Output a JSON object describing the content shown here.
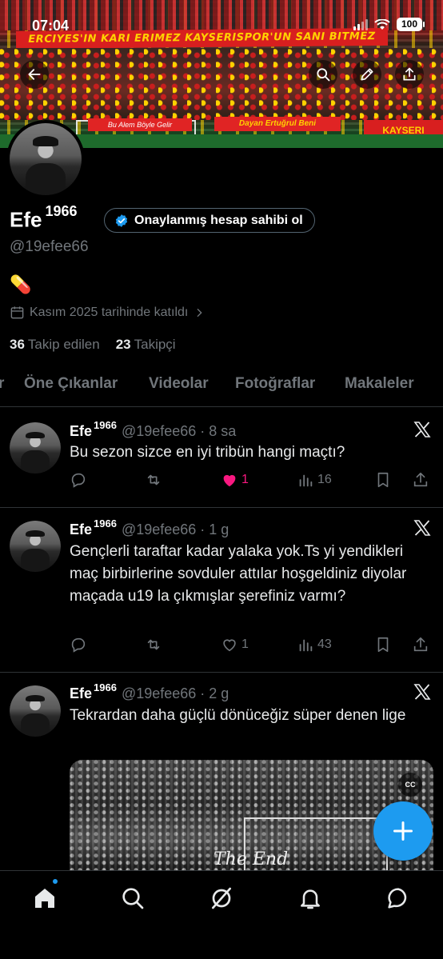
{
  "status_bar": {
    "time": "07:04",
    "battery": "100"
  },
  "banner": {
    "flag_top": "ERCIYES'IN KARI ERIMEZ KAYSERISPOR'UN SANI BITMEZ",
    "flag_left": "Bu Alem Böyle Gelir",
    "flag_mid": "Dayan Ertuğrul Beni",
    "flag_right": "KAYSERI"
  },
  "header": {
    "back_label": "Geri",
    "search_label": "Ara",
    "edit_label": "Düzenle",
    "share_label": "Paylaş"
  },
  "profile": {
    "name": "Efe",
    "name_sup": "1966",
    "verify_cta": "Onaylanmış hesap sahibi ol",
    "handle": "@19efee66",
    "bio": "💊",
    "joined": "Kasım 2025 tarihinde katıldı",
    "following_count": "36",
    "following_label": "Takip edilen",
    "followers_count": "23",
    "followers_label": "Takipçi"
  },
  "tabs": [
    "r",
    "Öne Çıkanlar",
    "Videolar",
    "Fotoğraflar",
    "Makaleler"
  ],
  "tweets": [
    {
      "name": "Efe",
      "name_sup": "1966",
      "handle": "@19efee66",
      "time": "8 sa",
      "text": "Bu sezon sizce en iyi tribün hangi maçtı?",
      "replies": "",
      "retweets": "",
      "likes": "1",
      "liked": true,
      "views": "16"
    },
    {
      "name": "Efe",
      "name_sup": "1966",
      "handle": "@19efee66",
      "time": "1 g",
      "text": "Gençlerli taraftar kadar yalaka yok.Ts yi yendikleri maç birbirlerine sovduler attılar hoşgeldiniz diyolar maçada u19 la çıkmışlar şerefiniz varmı?",
      "replies": "",
      "retweets": "",
      "likes": "1",
      "liked": false,
      "views": "43"
    },
    {
      "name": "Efe",
      "name_sup": "1966",
      "handle": "@19efee66",
      "time": "2 g",
      "text": "Tekrardan daha güçlü dönüceğiz süper denen lige",
      "media_caption": "The End",
      "cc_label": "CC"
    }
  ],
  "colors": {
    "accent": "#1d9bf0",
    "like": "#f91880",
    "muted": "#71767b",
    "border": "#2f3336"
  }
}
